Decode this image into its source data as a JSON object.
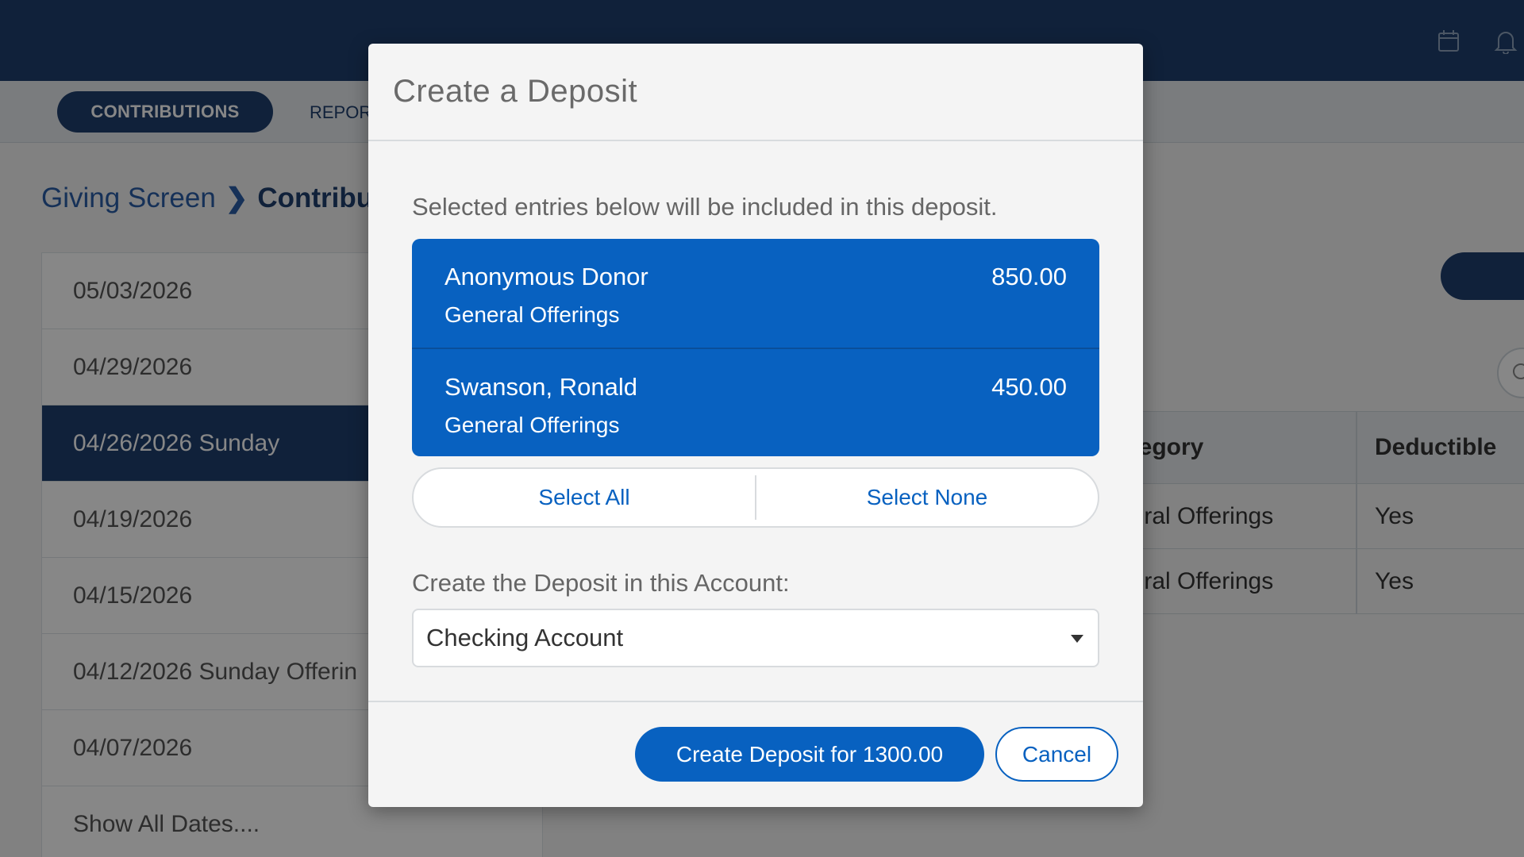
{
  "background": {
    "nav": {
      "active_tab": "CONTRIBUTIONS",
      "other_tab": "REPOR"
    },
    "breadcrumb": {
      "parent": "Giving Screen",
      "current": "Contributi"
    },
    "dates": [
      "05/03/2026",
      "04/29/2026",
      "04/26/2026 Sunday",
      "04/19/2026",
      "04/15/2026",
      "04/12/2026 Sunday Offerin",
      "04/07/2026",
      "Show All Dates...."
    ],
    "active_date_index": 2,
    "table": {
      "headers": [
        "ategory",
        "Deductible"
      ],
      "rows": [
        [
          "neral Offerings",
          "Yes"
        ],
        [
          "neral Offerings",
          "Yes"
        ]
      ]
    },
    "icons": [
      "calendar-icon",
      "bell-icon",
      "search-icon"
    ]
  },
  "modal": {
    "title": "Create a Deposit",
    "intro": "Selected entries below will be included in this deposit.",
    "entries": [
      {
        "name": "Anonymous Donor",
        "category": "General Offerings",
        "amount": "850.00",
        "selected": true
      },
      {
        "name": "Swanson, Ronald",
        "category": "General Offerings",
        "amount": "450.00",
        "selected": true
      }
    ],
    "select_all": "Select All",
    "select_none": "Select None",
    "account_label": "Create the Deposit in this Account:",
    "account_value": "Checking Account",
    "create_button": "Create Deposit for 1300.00",
    "cancel_button": "Cancel"
  },
  "colors": {
    "header": "#1f3f6e",
    "accent": "#0861c0",
    "overlay": "rgba(0,0,0,0.47)"
  }
}
